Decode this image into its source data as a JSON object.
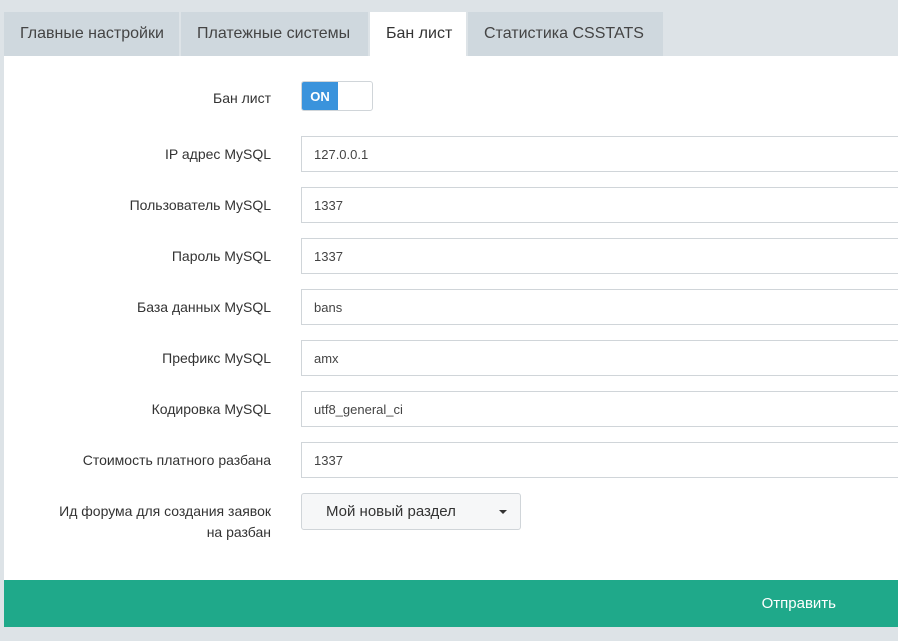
{
  "tabs": [
    {
      "label": "Главные настройки",
      "active": false
    },
    {
      "label": "Платежные системы",
      "active": false
    },
    {
      "label": "Бан лист",
      "active": true
    },
    {
      "label": "Статистика CSSTATS",
      "active": false
    }
  ],
  "form": {
    "banlist": {
      "label": "Бан лист",
      "toggle": "ON"
    },
    "ip": {
      "label": "IP адрес MySQL",
      "value": "127.0.0.1"
    },
    "user": {
      "label": "Пользователь MySQL",
      "value": "1337"
    },
    "password": {
      "label": "Пароль MySQL",
      "value": "1337"
    },
    "database": {
      "label": "База данных MySQL",
      "value": "bans"
    },
    "prefix": {
      "label": "Префикс MySQL",
      "value": "amx"
    },
    "encoding": {
      "label": "Кодировка MySQL",
      "value": "utf8_general_ci"
    },
    "price": {
      "label": "Стоимость платного разбана",
      "value": "1337"
    },
    "forum": {
      "label_line1": "Ид форума для создания заявок",
      "label_line2": "на разбан",
      "selected": "Мой новый раздел"
    }
  },
  "submit_label": "Отправить",
  "colors": {
    "accent": "#3a93dc",
    "submit": "#1fa98a"
  }
}
